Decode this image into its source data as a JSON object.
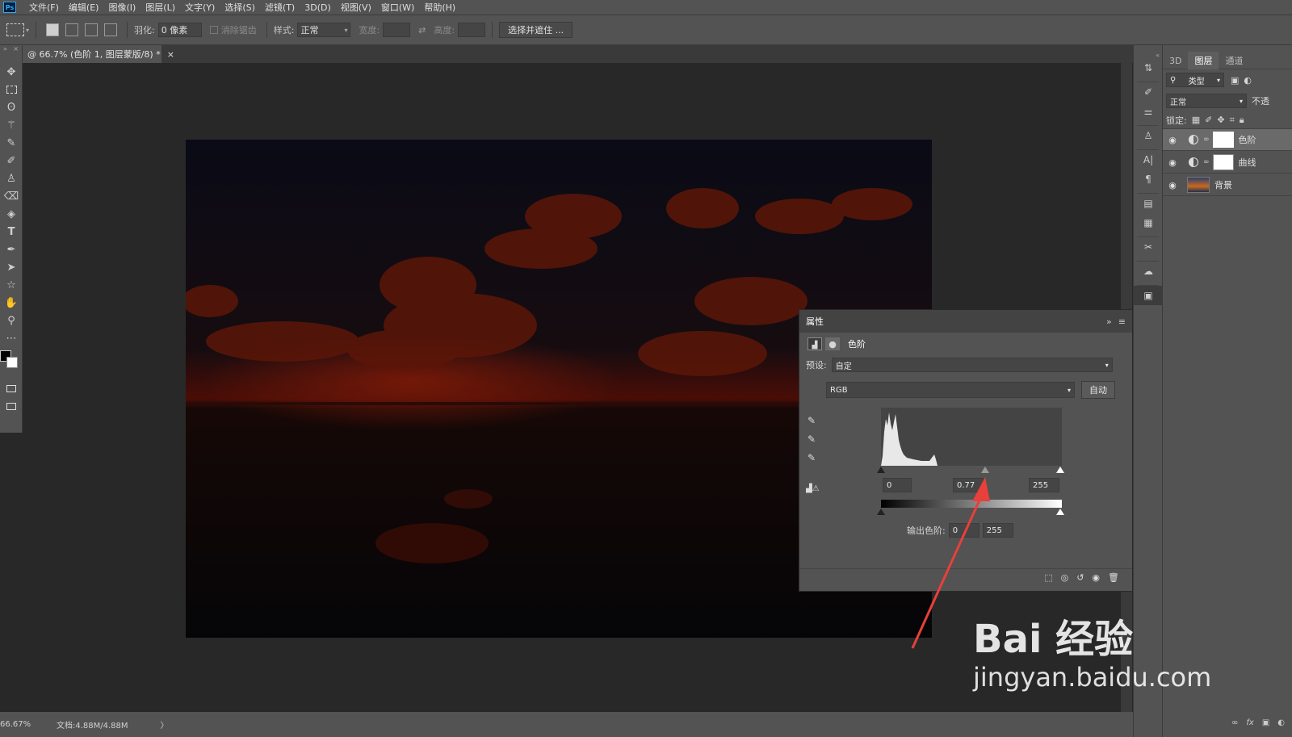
{
  "app": {
    "logo": "Ps",
    "menus": [
      "文件(F)",
      "编辑(E)",
      "图像(I)",
      "图层(L)",
      "文字(Y)",
      "选择(S)",
      "滤镜(T)",
      "3D(D)",
      "视图(V)",
      "窗口(W)",
      "帮助(H)"
    ]
  },
  "options": {
    "feather_label": "羽化:",
    "feather_value": "0 像素",
    "antialias_label": "消除锯齿",
    "style_label": "样式:",
    "style_value": "正常",
    "width_label": "宽度:",
    "height_label": "高度:",
    "select_mask_button": "选择并遮住 ..."
  },
  "document": {
    "tab_title": "@ 66.7% (色阶 1, 图层蒙版/8) *",
    "close": "×"
  },
  "status": {
    "zoom": "66.67%",
    "doc_size": "文档:4.88M/4.88M",
    "arrow": "〉"
  },
  "layers_panel": {
    "tabs": [
      "3D",
      "图层",
      "通道"
    ],
    "active_tab": "图层",
    "filter_label": "类型",
    "blend_mode": "正常",
    "opacity_label": "不透",
    "lock_label": "锁定:",
    "layers": [
      {
        "name": "色阶",
        "type": "adjustment",
        "visible": true,
        "selected": true
      },
      {
        "name": "曲线",
        "type": "adjustment",
        "visible": true,
        "selected": false
      },
      {
        "name": "背景",
        "type": "image",
        "visible": true,
        "selected": false
      }
    ],
    "footer_icons": [
      "link-icon",
      "fx-icon",
      "mask-icon",
      "adjustment-icon"
    ],
    "fx_label": "fx"
  },
  "properties_panel": {
    "title": "属性",
    "adjustment_name": "色阶",
    "preset_label": "预设:",
    "preset_value": "自定",
    "channel_value": "RGB",
    "auto_button": "自动",
    "input_black": "0",
    "input_gamma": "0.77",
    "input_white": "255",
    "output_label": "输出色阶:",
    "output_black": "0",
    "output_white": "255"
  },
  "watermark": {
    "brand": "Bai 经验",
    "url": "jingyan.baidu.com"
  },
  "colors": {
    "panel_bg": "#535353",
    "canvas_bg": "#282828",
    "arrow": "#e8403a"
  }
}
